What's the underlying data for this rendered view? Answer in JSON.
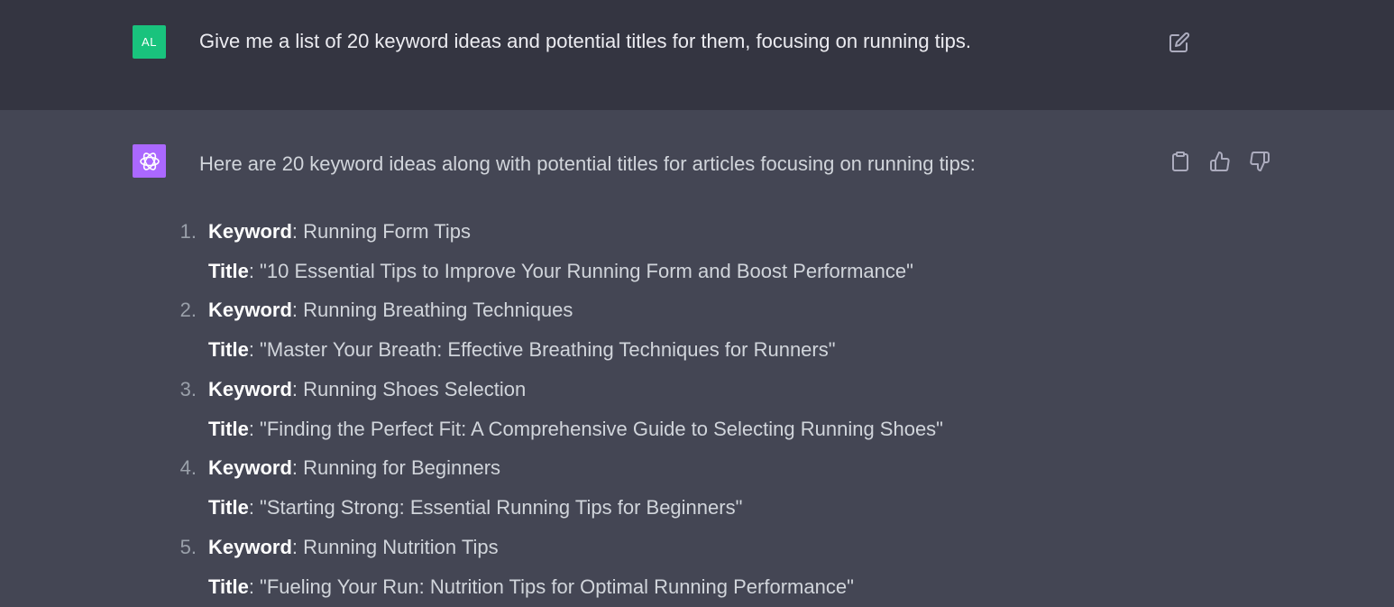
{
  "user": {
    "avatar_initials": "AL",
    "avatar_color": "#19c37d",
    "message": "Give me a list of 20 keyword ideas and potential titles for them, focusing on running tips.",
    "edit_icon": "edit-icon"
  },
  "assistant": {
    "avatar_color": "#ab68ff",
    "avatar_icon": "openai-logo-icon",
    "intro": "Here are 20 keyword ideas along with potential titles for articles focusing on running tips:",
    "actions": {
      "copy_icon": "clipboard-icon",
      "like_icon": "thumbs-up-icon",
      "dislike_icon": "thumbs-down-icon"
    },
    "keyword_label": "Keyword",
    "title_label": "Title",
    "items": [
      {
        "num": "1.",
        "keyword": ": Running Form Tips",
        "title": ": \"10 Essential Tips to Improve Your Running Form and Boost Performance\""
      },
      {
        "num": "2.",
        "keyword": ": Running Breathing Techniques",
        "title": ": \"Master Your Breath: Effective Breathing Techniques for Runners\""
      },
      {
        "num": "3.",
        "keyword": ": Running Shoes Selection",
        "title": ": \"Finding the Perfect Fit: A Comprehensive Guide to Selecting Running Shoes\""
      },
      {
        "num": "4.",
        "keyword": ": Running for Beginners",
        "title": ": \"Starting Strong: Essential Running Tips for Beginners\""
      },
      {
        "num": "5.",
        "keyword": ": Running Nutrition Tips",
        "title": ": \"Fueling Your Run: Nutrition Tips for Optimal Running Performance\""
      }
    ]
  },
  "colors": {
    "user_bg": "#343541",
    "assistant_bg": "#444654",
    "text": "#d1d5db"
  }
}
